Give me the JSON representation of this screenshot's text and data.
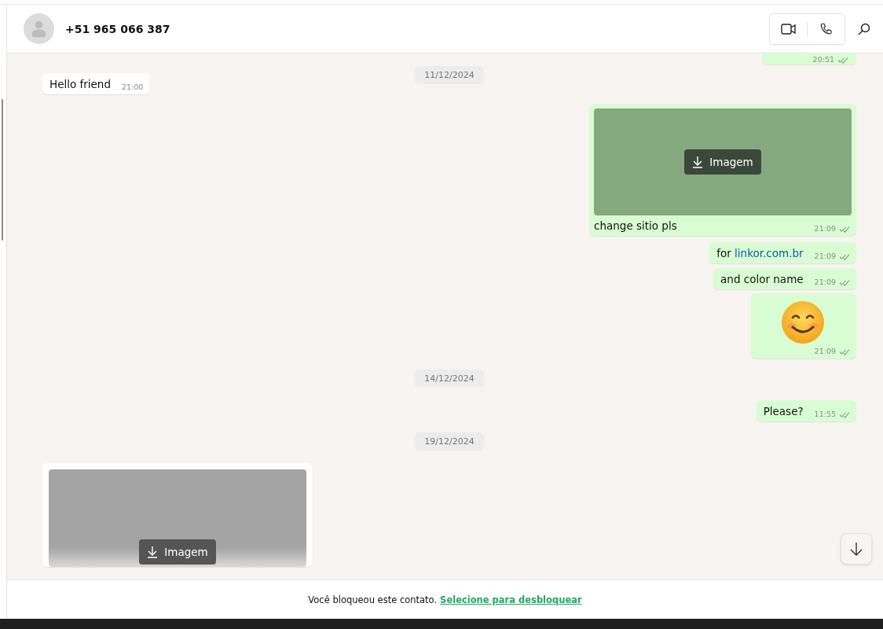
{
  "header": {
    "contact": "+51 965 066 387"
  },
  "messages": [
    {
      "kind": "partial",
      "outgoing": true,
      "time": "20:51",
      "delivered": true
    },
    {
      "kind": "date",
      "label": "11/12/2024"
    },
    {
      "kind": "text",
      "outgoing": false,
      "text": "Hello friend",
      "time": "21:00"
    },
    {
      "kind": "image",
      "outgoing": true,
      "button": "Imagem",
      "caption": "change sitio pls",
      "time": "21:09",
      "delivered": true
    },
    {
      "kind": "link",
      "outgoing": true,
      "text": "for",
      "link": "linkor.com.br",
      "time": "21:09",
      "delivered": true
    },
    {
      "kind": "text",
      "outgoing": true,
      "text": "and color name",
      "time": "21:09",
      "delivered": true
    },
    {
      "kind": "emoji",
      "outgoing": true,
      "time": "21:09",
      "delivered": true
    },
    {
      "kind": "date",
      "label": "14/12/2024"
    },
    {
      "kind": "text",
      "outgoing": true,
      "text": "Please?",
      "time": "11:55",
      "delivered": true
    },
    {
      "kind": "date",
      "label": "19/12/2024"
    },
    {
      "kind": "image",
      "outgoing": false,
      "button": "Imagem"
    }
  ],
  "footer": {
    "notice": "Você bloqueou este contato.",
    "link": "Selecione para desbloquear"
  }
}
